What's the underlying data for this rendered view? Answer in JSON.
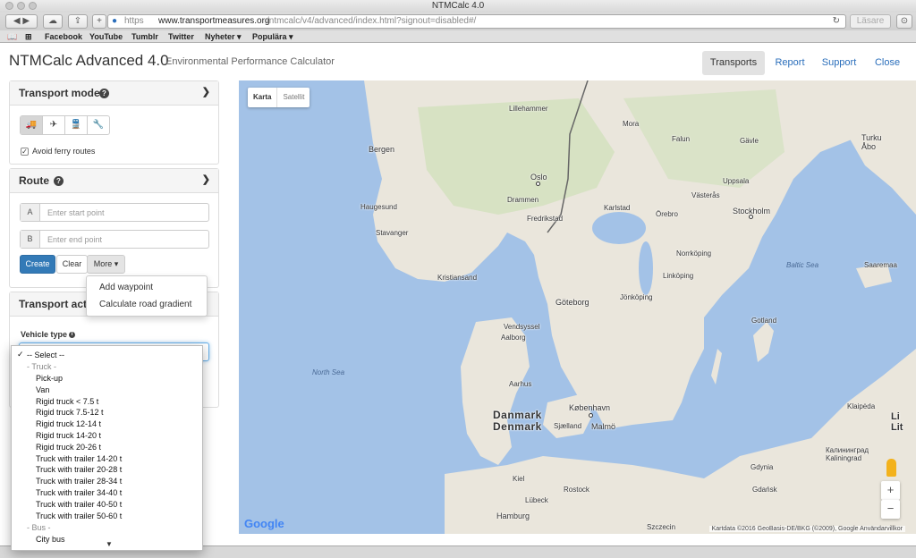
{
  "browser": {
    "window_title": "NTMCalc 4.0",
    "url_scheme": "https",
    "url_host": "www.transportmeasures.org",
    "url_path": "/ntmcalc/v4/advanced/index.html?signout=disabled#/",
    "reader_label": "Läsare",
    "bookmarks": [
      "Facebook",
      "YouTube",
      "Tumblr",
      "Twitter",
      "Nyheter ▾",
      "Populära ▾"
    ]
  },
  "header": {
    "title": "NTMCalc Advanced 4.0",
    "subtitle": "Environmental Performance Calculator",
    "nav": [
      "Transports",
      "Report",
      "Support",
      "Close"
    ]
  },
  "transport_mode": {
    "title": "Transport mode",
    "modes": [
      {
        "icon": "truck-icon",
        "glyph": "🚚"
      },
      {
        "icon": "airplane-icon",
        "glyph": "✈"
      },
      {
        "icon": "train-icon",
        "glyph": "🚆"
      },
      {
        "icon": "wrench-icon",
        "glyph": "🔧"
      }
    ],
    "avoid_ferry_label": "Avoid ferry routes"
  },
  "route": {
    "title": "Route",
    "start_letter": "A",
    "start_placeholder": "Enter start point",
    "end_letter": "B",
    "end_placeholder": "Enter end point",
    "create_label": "Create",
    "clear_label": "Clear",
    "more_label": "More ▾",
    "more_menu": [
      "Add waypoint",
      "Calculate road gradient"
    ]
  },
  "transport_activity": {
    "title": "Transport activ",
    "vehicle_type_label": "Vehicle type",
    "dropdown": {
      "selected": "-- Select --",
      "group_truck": "- Truck -",
      "truck_options": [
        "Pick-up",
        "Van",
        "Rigid truck < 7.5 t",
        "Rigid truck 7.5-12 t",
        "Rigid truck 12-14 t",
        "Rigid truck 14-20 t",
        "Rigid truck 20-26 t",
        "Truck with trailer 14-20 t",
        "Truck with trailer 20-28 t",
        "Truck with trailer 28-34 t",
        "Truck with trailer 34-40 t",
        "Truck with trailer 40-50 t",
        "Truck with trailer 50-60 t"
      ],
      "group_bus": "- Bus -",
      "bus_options": [
        "City bus"
      ]
    }
  },
  "map": {
    "type_buttons": [
      "Karta",
      "Satellit"
    ],
    "labels": {
      "lillehammer": "Lillehammer",
      "bergen": "Bergen",
      "oslo": "Oslo",
      "drammen": "Drammen",
      "haugesund": "Haugesund",
      "fredrikstad": "Fredrikstad",
      "stavanger": "Stavanger",
      "kristiansand": "Kristiansand",
      "mora": "Mora",
      "falun": "Falun",
      "gavle": "Gävle",
      "uppsala": "Uppsala",
      "vasteras": "Västerås",
      "karlstad": "Karlstad",
      "orebro": "Örebro",
      "stockholm": "Stockholm",
      "norrkoping": "Norrköping",
      "linkoping": "Linköping",
      "jonkoping": "Jönköping",
      "goteborg": "Göteborg",
      "turku": "Turku\nÅbo",
      "baltic_sea": "Baltic Sea",
      "saaremaa": "Saaremaa",
      "gotland": "Gotland",
      "vendsyssel": "Vendsyssel",
      "aalborg": "Aalborg",
      "north_sea": "North Sea",
      "aarhus": "Aarhus",
      "danmark": "Danmark",
      "denmark": "Denmark",
      "kobenhavn": "København",
      "sjaelland": "Sjælland",
      "malmo": "Malmö",
      "klaipeda": "Klaipėda",
      "kaliningrad": "Калининград\nKaliningrad",
      "gdynia": "Gdynia",
      "gdansk": "Gdańsk",
      "kiel": "Kiel",
      "lubeck": "Lübeck",
      "rostock": "Rostock",
      "hamburg": "Hamburg",
      "szczecin": "Szczecin",
      "lit": "Li\nLit"
    },
    "google_logo": "Google",
    "attribution": "Kartdata ©2016 GeoBasis-DE/BKG (©2009), Google   Användarvillkor",
    "zoom_in": "+",
    "zoom_out": "−"
  }
}
